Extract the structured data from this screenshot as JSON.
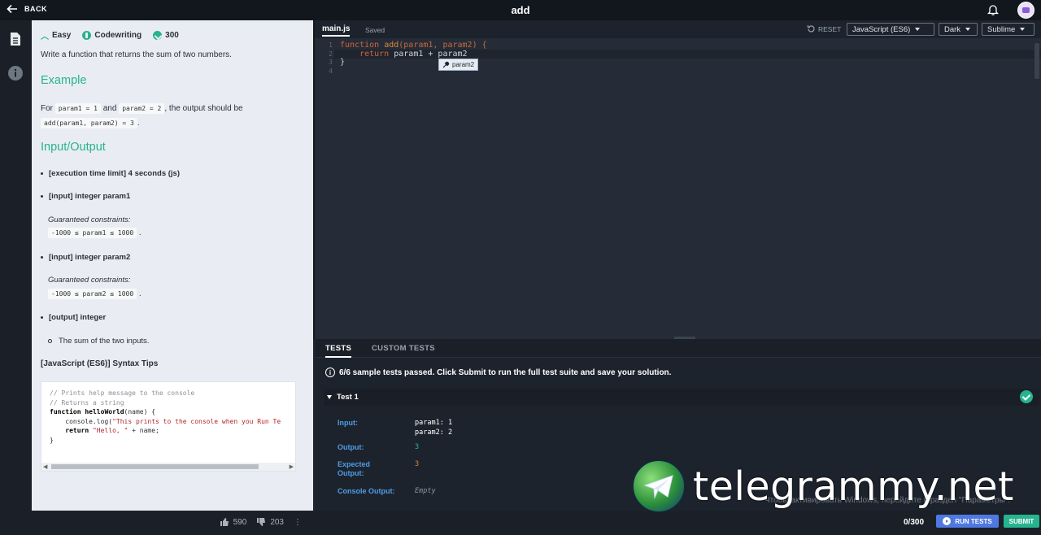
{
  "topbar": {
    "back_label": "BACK",
    "title": "add"
  },
  "meta": {
    "difficulty": "Easy",
    "category": "Codewriting",
    "points": "300"
  },
  "description": {
    "intro": "Write a function that returns the sum of two numbers.",
    "example_heading": "Example",
    "example_for": "For",
    "example_code1": "param1 = 1",
    "example_and": "and",
    "example_code2": "param2 = 2",
    "example_output": ", the output should be",
    "example_code3": "add(param1, param2) = 3",
    "example_end": ".",
    "io_heading": "Input/Output",
    "exec_limit": "[execution time limit] 4 seconds (js)",
    "input1": "[input] integer param1",
    "guaranteed1": "Guaranteed constraints:",
    "constraint1": "-1000 ≤ param1 ≤ 1000",
    "input2": "[input] integer param2",
    "guaranteed2": "Guaranteed constraints:",
    "constraint2": "-1000 ≤ param2 ≤ 1000",
    "output": "[output] integer",
    "output_desc": "The sum of the two inputs.",
    "tips_heading": "[JavaScript (ES6)] Syntax Tips",
    "snippet": {
      "line1": "// Prints help message to the console",
      "line2": "// Returns a string",
      "line3_kw": "function",
      "line3_name": "helloWorld",
      "line3_rest": "(name) {",
      "line4a": "    console.log(",
      "line4b": "\"This prints to the console when you Run Te",
      "line5_kw": "    return",
      "line5_str": " \"Hello, \"",
      "line5_rest": " + name;",
      "line6": "}"
    }
  },
  "votes": {
    "up": "590",
    "down": "203"
  },
  "editor": {
    "tab": "main.js",
    "status": "Saved",
    "reset": "RESET",
    "language": "JavaScript (ES6)",
    "theme": "Dark",
    "keymap": "Sublime",
    "line_numbers": [
      "1",
      "2",
      "3",
      "4"
    ],
    "code": {
      "l1_kw": "function",
      "l1_fn": " add",
      "l1_p1": "(param1, param2) {",
      "l2_kw": "    return",
      "l2_rest": " param1 + param2",
      "l3": "}"
    },
    "autocomplete": "param2"
  },
  "tests": {
    "tab_tests": "TESTS",
    "tab_custom": "CUSTOM TESTS",
    "summary": "6/6 sample tests passed. Click Submit to run the full test suite and save your solution.",
    "test1": {
      "label": "Test 1",
      "input_label": "Input:",
      "input_value": "param1: 1\nparam2: 2",
      "output_label": "Output:",
      "output_value": "3",
      "expected_label": "Expected\nOutput:",
      "expected_value": "3",
      "console_label": "Console Output:",
      "console_value": "Empty"
    }
  },
  "footer": {
    "count": "0/300",
    "run_tests": "RUN TESTS",
    "submit": "SUBMIT"
  },
  "watermark": {
    "text": "telegrammy.net",
    "ghost_text": "Чтобы активировать Windows, перейдите в раздел \"Параметры\"."
  },
  "colors": {
    "accent_green": "#27b38f",
    "run_blue": "#4f78e0",
    "label_blue": "#4f9de8"
  }
}
